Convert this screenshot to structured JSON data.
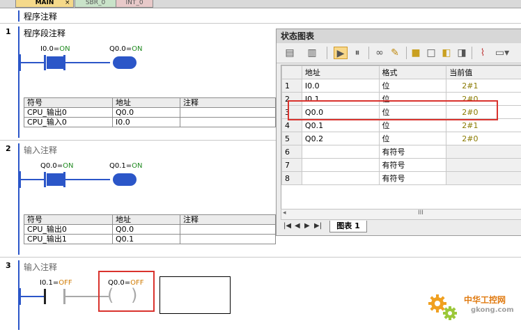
{
  "tabs": [
    {
      "label": "MAIN",
      "close": "×"
    },
    {
      "label": "SBR_0"
    },
    {
      "label": "INT_0"
    }
  ],
  "program_comment": "程序注释",
  "networks": [
    {
      "number": "1",
      "comment": "程序段注释",
      "contact": {
        "address": "I0.0",
        "sep": "=",
        "state": "ON"
      },
      "coil": {
        "address": "Q0.0",
        "sep": "=",
        "state": "ON"
      },
      "symbols": {
        "headers": [
          "符号",
          "地址",
          "注释"
        ],
        "rows": [
          [
            "CPU_输出0",
            "Q0.0",
            ""
          ],
          [
            "CPU_输入0",
            "I0.0",
            ""
          ]
        ]
      }
    },
    {
      "number": "2",
      "comment": "输入注释",
      "contact": {
        "address": "Q0.0",
        "sep": "=",
        "state": "ON"
      },
      "coil": {
        "address": "Q0.1",
        "sep": "=",
        "state": "ON"
      },
      "symbols": {
        "headers": [
          "符号",
          "地址",
          "注释"
        ],
        "rows": [
          [
            "CPU_输出0",
            "Q0.0",
            ""
          ],
          [
            "CPU_输出1",
            "Q0.1",
            ""
          ]
        ]
      }
    },
    {
      "number": "3",
      "comment": "输入注释",
      "contact": {
        "address": "I0.1",
        "sep": "=",
        "state": "OFF"
      },
      "coil": {
        "address": "Q0.0",
        "sep": "=",
        "state": "OFF"
      }
    }
  ],
  "status_chart": {
    "title": "状态图表",
    "headers": [
      "地址",
      "格式",
      "当前值"
    ],
    "rows": [
      {
        "n": "1",
        "address": "I0.0",
        "format": "位",
        "value": "2#1"
      },
      {
        "n": "2",
        "address": "I0.1",
        "format": "位",
        "value": "2#0"
      },
      {
        "n": "3",
        "address": "Q0.0",
        "format": "位",
        "value": "2#0"
      },
      {
        "n": "4",
        "address": "Q0.1",
        "format": "位",
        "value": "2#1"
      },
      {
        "n": "5",
        "address": "Q0.2",
        "format": "位",
        "value": "2#0"
      },
      {
        "n": "6",
        "address": "",
        "format": "有符号",
        "value": ""
      },
      {
        "n": "7",
        "address": "",
        "format": "有符号",
        "value": ""
      },
      {
        "n": "8",
        "address": "",
        "format": "有符号",
        "value": ""
      }
    ],
    "scroll_thumb": "III",
    "sheet_tab": "图表 1",
    "nav": [
      "|◀",
      "◀",
      "▶",
      "▶|"
    ]
  },
  "watermark": {
    "brand": "中华工控网",
    "url": "gkong.com"
  },
  "colors": {
    "energized": "#2b56c8",
    "on_text": "#1f8a1f",
    "off_text": "#d07a00",
    "highlight": "#d9322d"
  }
}
